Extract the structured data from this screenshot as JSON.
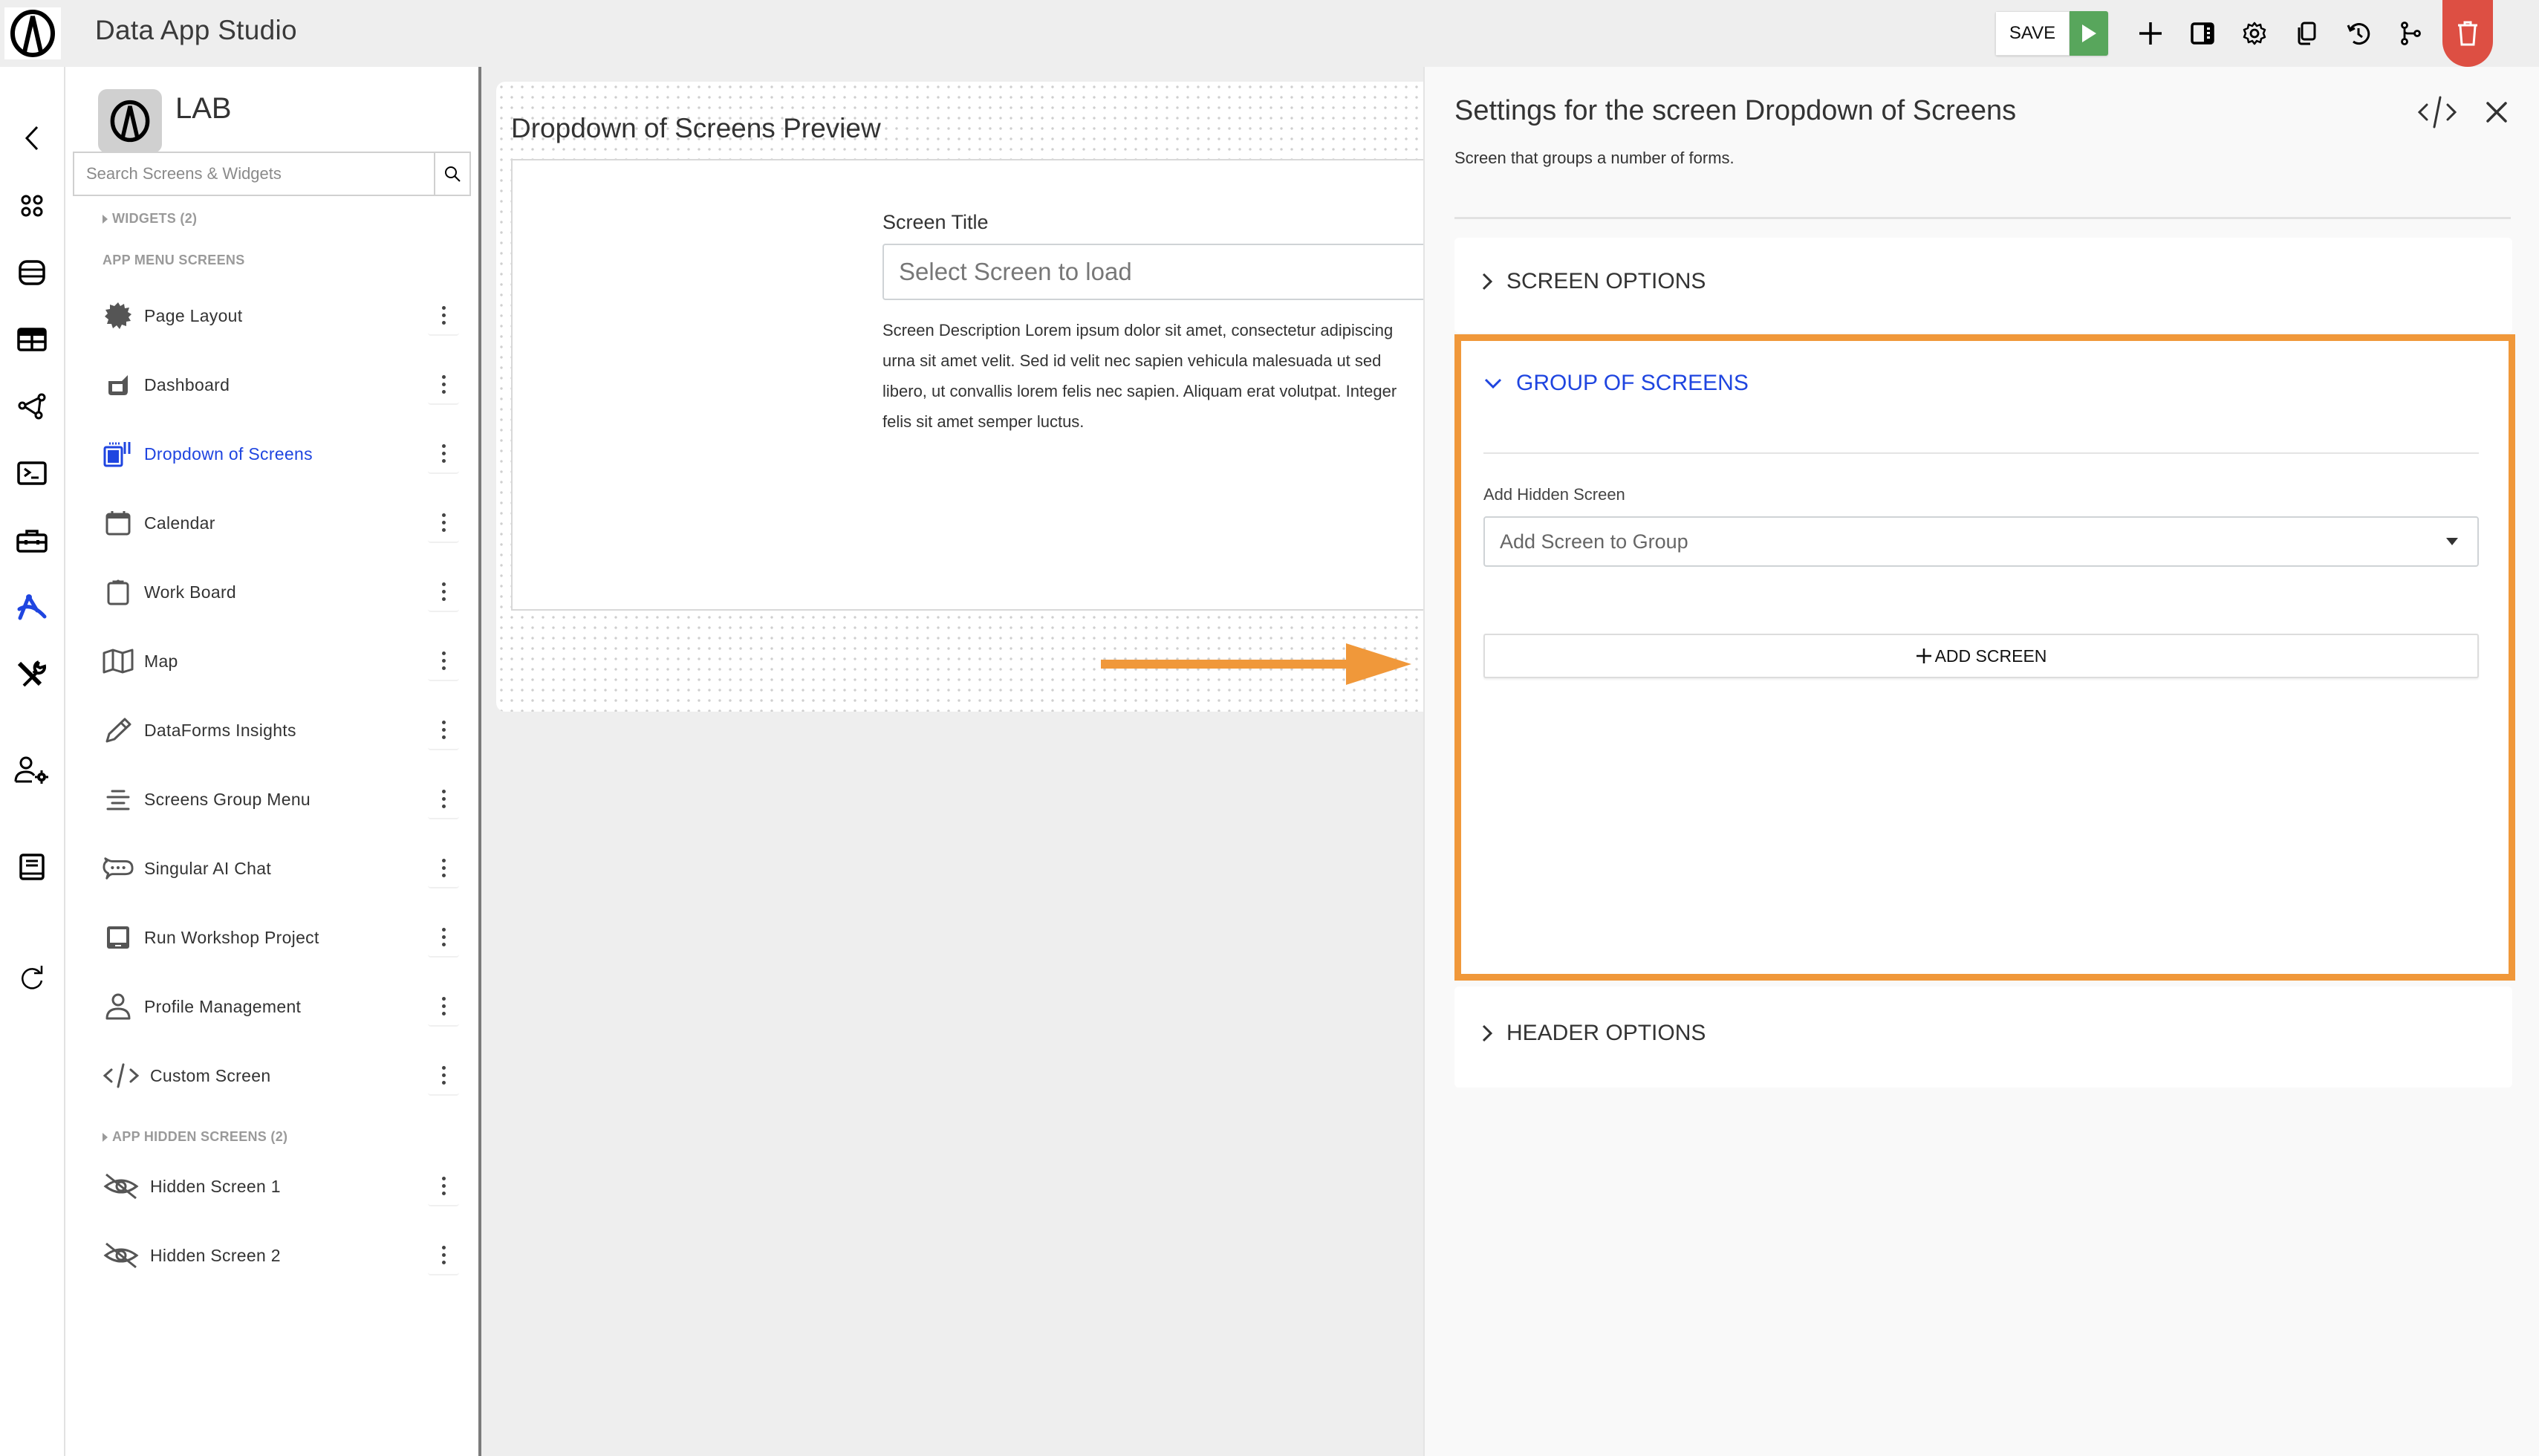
{
  "app": {
    "title": "Data App Studio",
    "logo_icon": "brand-logo-icon"
  },
  "toolbar": {
    "save_label": "SAVE",
    "buttons": [
      {
        "name": "run",
        "icon": "play-icon"
      },
      {
        "name": "add",
        "icon": "plus-icon"
      },
      {
        "name": "layout",
        "icon": "panel-layout-icon"
      },
      {
        "name": "settings",
        "icon": "gear-icon"
      },
      {
        "name": "duplicate",
        "icon": "copy-icon"
      },
      {
        "name": "history",
        "icon": "history-icon"
      },
      {
        "name": "branch",
        "icon": "branch-icon"
      },
      {
        "name": "delete",
        "icon": "trash-icon"
      }
    ],
    "colors": {
      "run": "#58a65c",
      "delete": "#dd4f43"
    }
  },
  "rail": {
    "items": [
      {
        "name": "back",
        "icon": "chevron-left-icon"
      },
      {
        "name": "apps",
        "icon": "apps-grid-icon"
      },
      {
        "name": "database",
        "icon": "database-icon"
      },
      {
        "name": "tables",
        "icon": "table-icon"
      },
      {
        "name": "graph",
        "icon": "graph-nodes-icon"
      },
      {
        "name": "terminal",
        "icon": "terminal-icon"
      },
      {
        "name": "toolbox",
        "icon": "toolbox-icon"
      },
      {
        "name": "app-studio",
        "icon": "compass-design-icon",
        "active": true
      },
      {
        "name": "tools",
        "icon": "tools-icon"
      },
      {
        "name": "user-settings",
        "icon": "user-gear-icon"
      },
      {
        "name": "docs",
        "icon": "book-icon"
      },
      {
        "name": "refresh",
        "icon": "refresh-icon"
      }
    ],
    "active_color": "#1f45e0"
  },
  "sidebar": {
    "lab_name": "LAB",
    "search_placeholder": "Search Screens & Widgets",
    "widgets_section": "WIDGETS (2)",
    "menu_section": "APP MENU SCREENS",
    "hidden_section": "APP HIDDEN SCREENS (2)",
    "menu_screens": [
      {
        "label": "Page Layout",
        "icon": "badge-icon"
      },
      {
        "label": "Dashboard",
        "icon": "dashboard-icon"
      },
      {
        "label": "Dropdown of Screens",
        "icon": "dropdown-screens-icon",
        "active": true
      },
      {
        "label": "Calendar",
        "icon": "calendar-icon"
      },
      {
        "label": "Work Board",
        "icon": "clipboard-icon"
      },
      {
        "label": "Map",
        "icon": "map-icon"
      },
      {
        "label": "DataForms Insights",
        "icon": "pencil-icon"
      },
      {
        "label": "Screens Group Menu",
        "icon": "align-center-icon"
      },
      {
        "label": "Singular AI Chat",
        "icon": "chat-bubble-icon"
      },
      {
        "label": "Run Workshop Project",
        "icon": "tablet-icon"
      },
      {
        "label": "Profile Management",
        "icon": "user-icon"
      },
      {
        "label": "Custom Screen",
        "icon": "code-icon"
      }
    ],
    "hidden_screens": [
      {
        "label": "Hidden Screen 1",
        "icon": "eye-off-icon"
      },
      {
        "label": "Hidden Screen 2",
        "icon": "eye-off-icon"
      }
    ]
  },
  "preview": {
    "title": "Dropdown of Screens Preview",
    "field_label": "Screen Title",
    "select_placeholder": "Select Screen to load",
    "description_lines": [
      "Screen Description Lorem ipsum dolor sit amet, consectetur adipiscing",
      "urna sit amet velit. Sed id velit nec sapien vehicula malesuada ut sed",
      "libero, ut convallis lorem felis nec sapien. Aliquam erat volutpat. Integer",
      "felis sit amet semper luctus."
    ],
    "annotation_color": "#f0983a"
  },
  "settings": {
    "title": "Settings for the screen Dropdown of Screens",
    "subtitle": "Screen that groups a number of forms.",
    "sections": [
      {
        "label": "SCREEN OPTIONS",
        "expanded": false
      },
      {
        "label": "GROUP OF SCREENS",
        "expanded": true
      },
      {
        "label": "HEADER OPTIONS",
        "expanded": false
      }
    ],
    "group": {
      "field_label": "Add Hidden Screen",
      "select_placeholder": "Add Screen to Group",
      "add_button": "ADD SCREEN"
    },
    "highlight_color": "#f0983a",
    "accent_color": "#1f45e0"
  }
}
